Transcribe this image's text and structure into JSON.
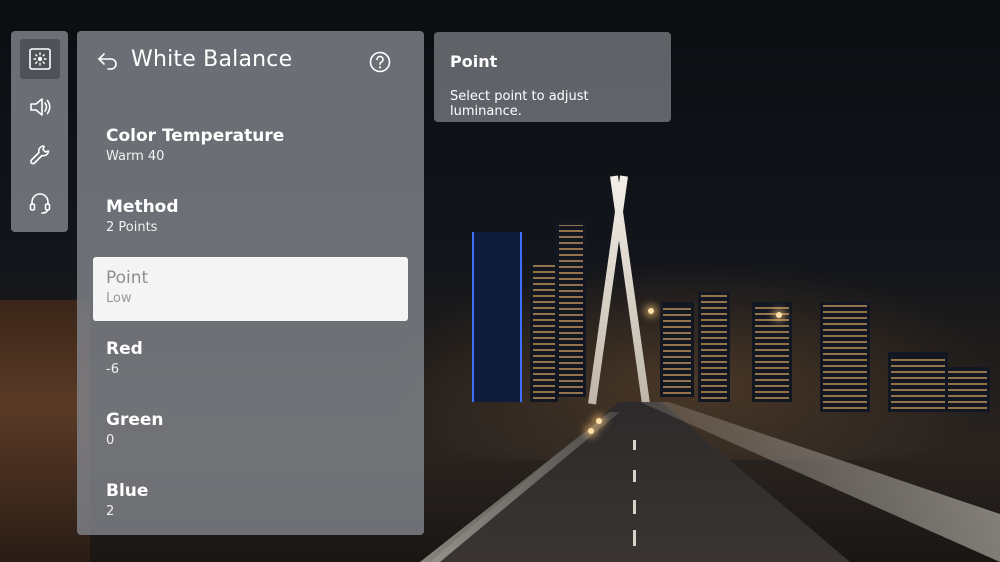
{
  "sidebar": {
    "items": [
      {
        "icon": "picture-settings-icon",
        "active": true
      },
      {
        "icon": "speaker-icon",
        "active": false
      },
      {
        "icon": "wrench-icon",
        "active": false
      },
      {
        "icon": "headset-icon",
        "active": false
      }
    ]
  },
  "panel": {
    "title": "White Balance",
    "back_icon": "back-arrow-icon",
    "help_icon": "help-circle-icon",
    "items": [
      {
        "label": "Color Temperature",
        "value": "Warm 40"
      },
      {
        "label": "Method",
        "value": "2 Points"
      },
      {
        "label": "Point",
        "value": "Low",
        "selected": true
      },
      {
        "label": "Red",
        "value": "-6"
      },
      {
        "label": "Green",
        "value": "0"
      },
      {
        "label": "Blue",
        "value": "2"
      }
    ]
  },
  "tooltip": {
    "title": "Point",
    "text": "Select point to adjust luminance."
  },
  "colors": {
    "panel_bg": "#80848a",
    "selected_bg": "#f4f4f4",
    "text": "#ffffff"
  }
}
